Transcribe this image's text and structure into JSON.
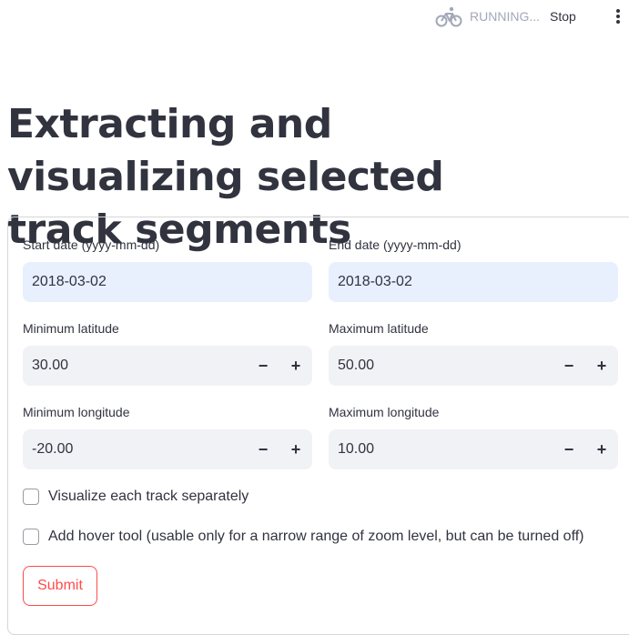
{
  "header": {
    "status_text": "RUNNING...",
    "status_icon": "bicycle-icon",
    "stop_label": "Stop",
    "menu_icon": "vertical-dots-icon"
  },
  "page": {
    "title": "Extracting and visualizing selected track segments"
  },
  "form": {
    "start_date": {
      "label": "Start date (yyyy-mm-dd)",
      "value": "2018-03-02"
    },
    "end_date": {
      "label": "End date (yyyy-mm-dd)",
      "value": "2018-03-02"
    },
    "min_lat": {
      "label": "Minimum latitude",
      "value": "30.00"
    },
    "max_lat": {
      "label": "Maximum latitude",
      "value": "50.00"
    },
    "min_lon": {
      "label": "Minimum longitude",
      "value": "-20.00"
    },
    "max_lon": {
      "label": "Maximum longitude",
      "value": "10.00"
    },
    "stepper": {
      "minus": "−",
      "plus": "+"
    },
    "check_separate": {
      "label": "Visualize each track separately",
      "checked": false
    },
    "check_hover": {
      "label": "Add hover tool (usable only for a narrow range of zoom level, but can be turned off)",
      "checked": false
    },
    "submit_label": "Submit"
  },
  "colors": {
    "accent": "#ff4b4b",
    "date_input_bg": "#e8f0fe",
    "number_input_bg": "#f0f2f6",
    "text": "#31333f",
    "status_gray": "#a3a8b8"
  }
}
